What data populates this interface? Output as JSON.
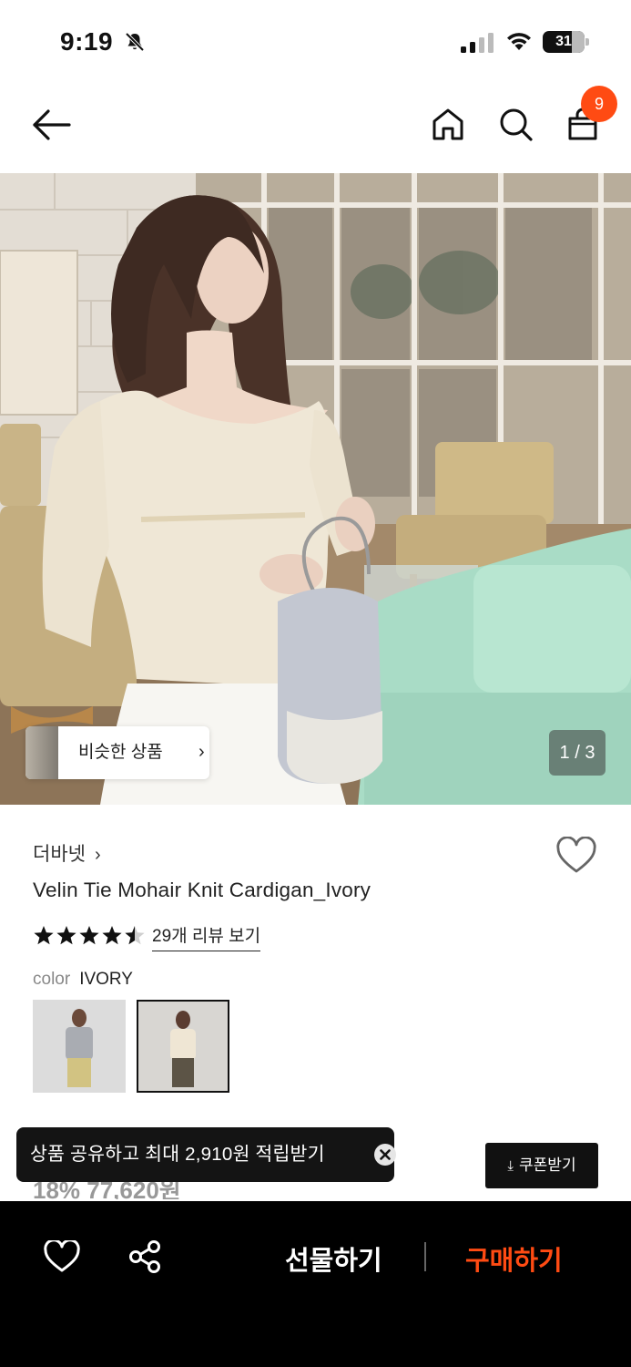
{
  "status_bar": {
    "time": "9:19",
    "battery": "31",
    "icons": [
      "bell-slash-icon",
      "signal-icon",
      "wifi-icon",
      "battery-icon"
    ]
  },
  "nav": {
    "icons": [
      "back-arrow-icon",
      "home-icon",
      "search-icon",
      "shopping-bag-icon"
    ],
    "cart_count": "9",
    "badge_color": "#ff4b13"
  },
  "hero": {
    "similar_label": "비슷한 상품",
    "similar_chevron": "›",
    "counter": "1 / 3"
  },
  "product": {
    "brand": "더바넷",
    "brand_chevron": "›",
    "title": "Velin Tie Mohair Knit Cardigan_Ivory",
    "rating": 4.5,
    "reviews_label": "29개 리뷰 보기",
    "color_key": "color",
    "color_value": "IVORY",
    "swatches": [
      "gray",
      "ivory"
    ],
    "selected_swatch": "ivory"
  },
  "toast": {
    "text": "상품 공유하고 최대 2,910원 적립받기"
  },
  "price_peek": "18% 77,620원",
  "coupon": {
    "label": "쿠폰받기",
    "icon": "download-icon"
  },
  "bottom_bar": {
    "gift_label": "선물하기",
    "buy_label": "구매하기",
    "buy_color": "#ff4b13",
    "icons": [
      "heart-icon",
      "share-icon"
    ]
  }
}
